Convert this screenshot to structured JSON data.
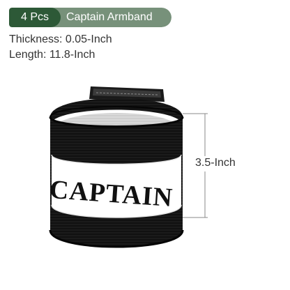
{
  "badge": {
    "quantity": "4 Pcs",
    "product_name": "Captain Armband",
    "quantity_color": "#2d5937",
    "name_color": "#77917a"
  },
  "specs": {
    "thickness": "Thickness: 0.05-Inch",
    "length": "Length: 11.8-Inch"
  },
  "armband": {
    "text": "CAPTAIN",
    "band_color": "#111111",
    "label_color": "#ffffff"
  },
  "dimension": {
    "height_label": "3.5-Inch"
  }
}
